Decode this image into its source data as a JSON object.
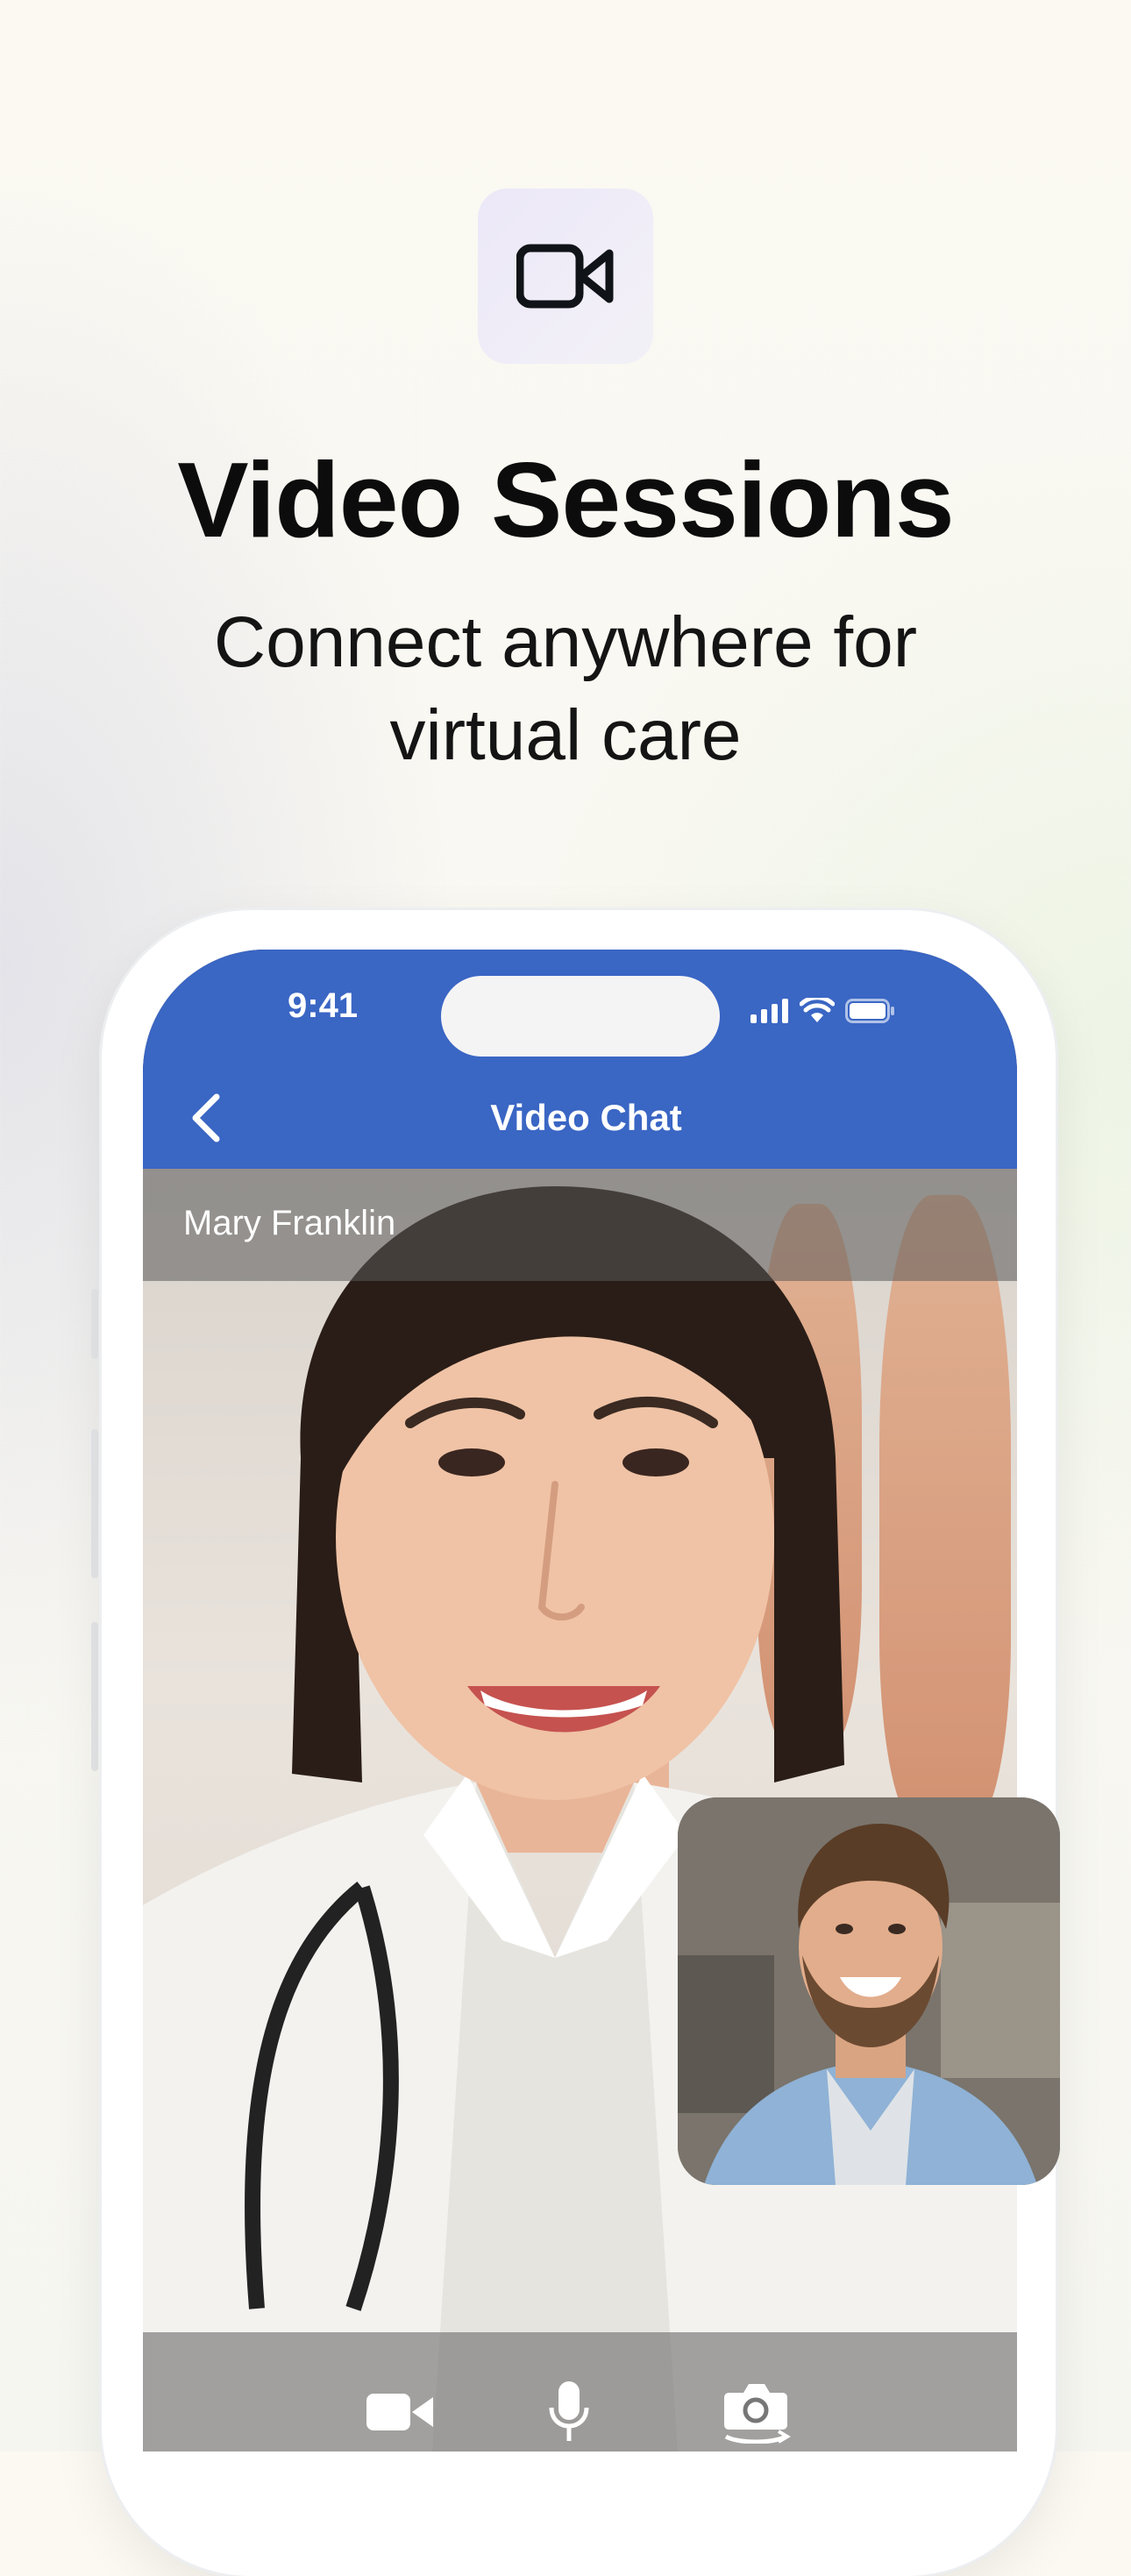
{
  "hero": {
    "icon": "video-camera-icon",
    "title": "Video Sessions",
    "subtitle": "Connect anywhere for virtual care"
  },
  "status_bar": {
    "time": "9:41",
    "icons": [
      "cellular-signal-icon",
      "wifi-icon",
      "battery-icon"
    ]
  },
  "app_header": {
    "back_icon": "chevron-left-icon",
    "title": "Video Chat",
    "color": "#3a66c4"
  },
  "call": {
    "caller_name": "Mary Franklin",
    "controls": [
      {
        "icon": "video-camera-icon",
        "label": "camera"
      },
      {
        "icon": "microphone-icon",
        "label": "microphone"
      },
      {
        "icon": "switch-camera-icon",
        "label": "switch camera"
      }
    ]
  }
}
